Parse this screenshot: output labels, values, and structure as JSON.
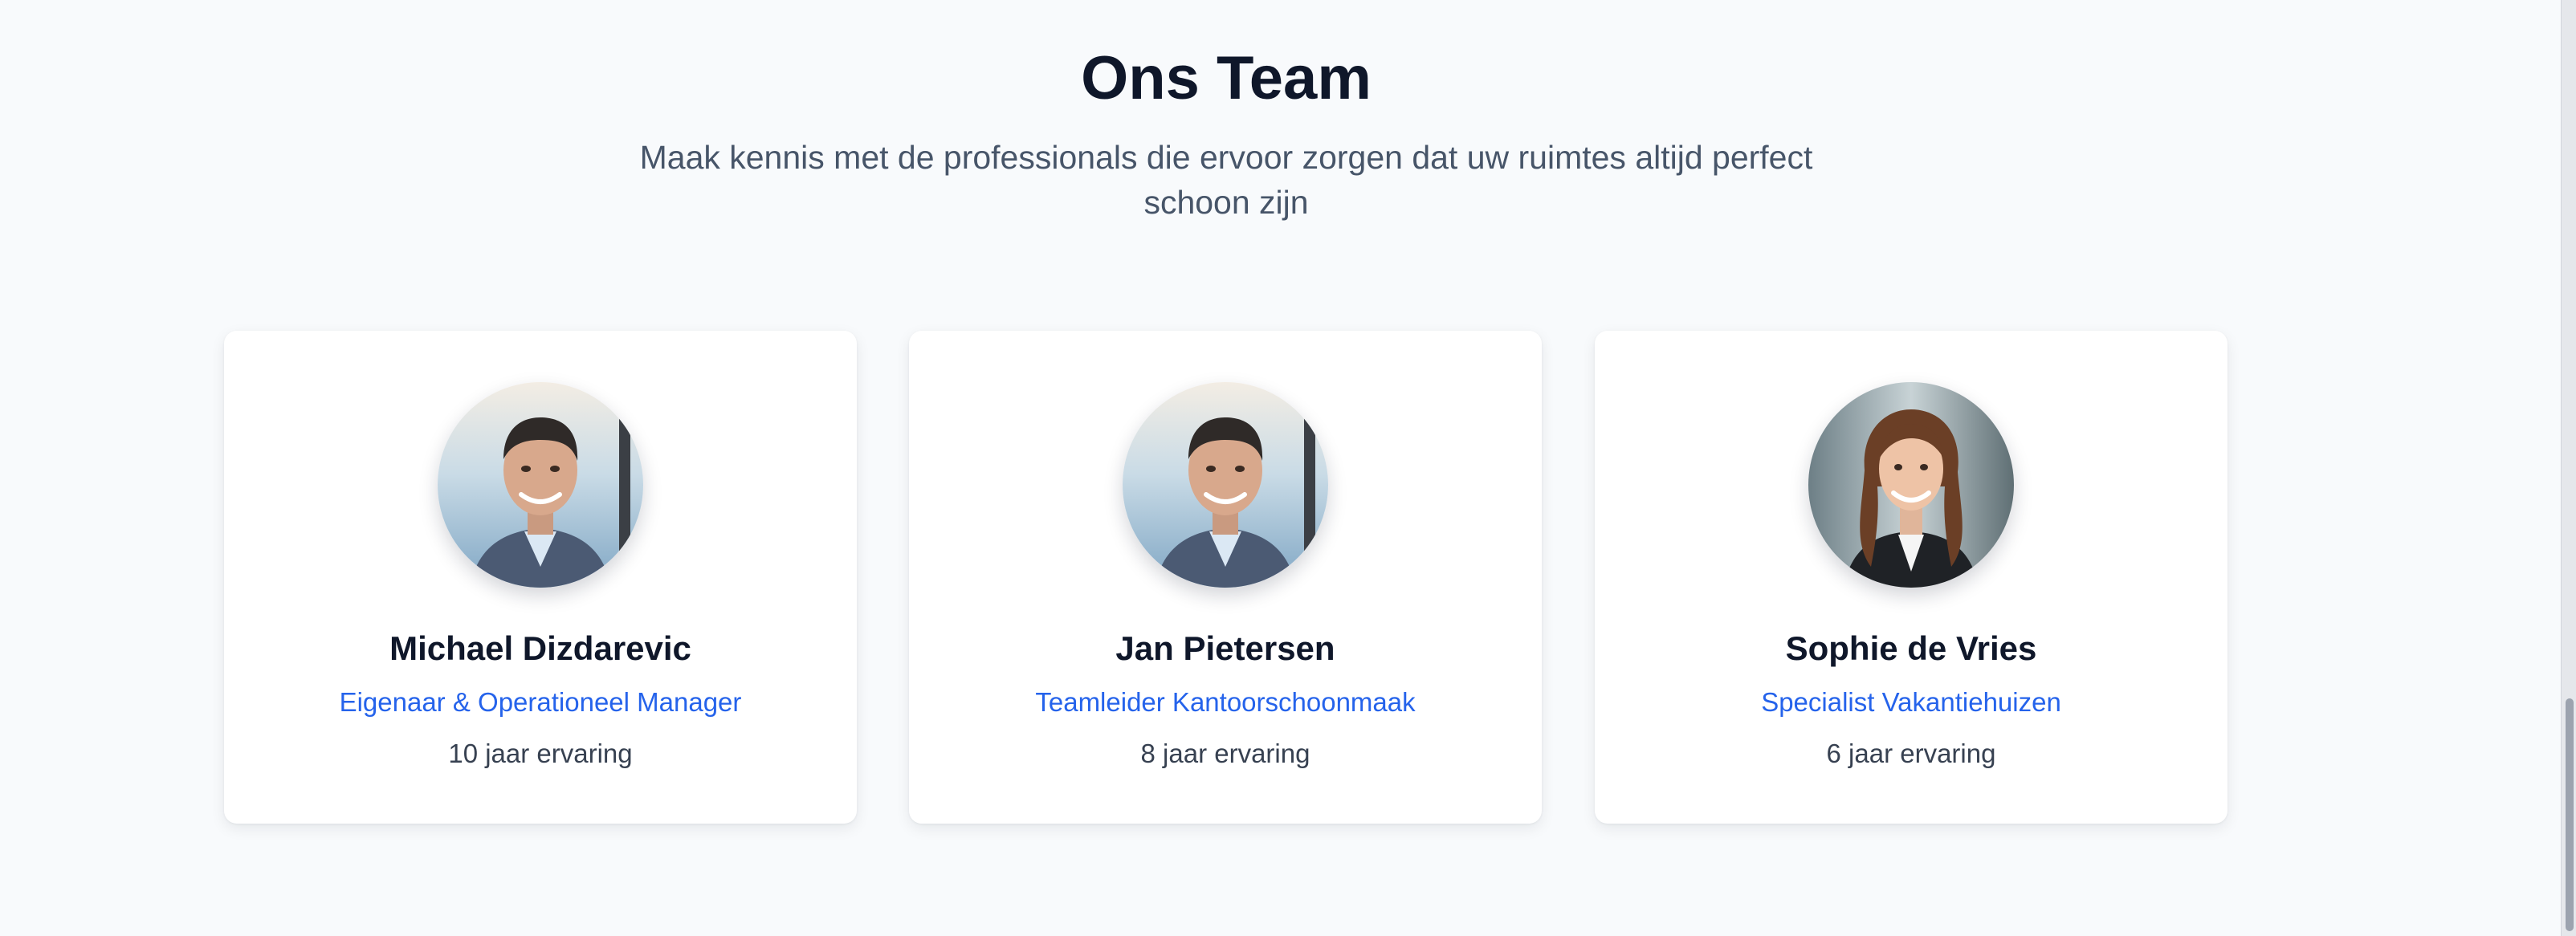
{
  "team": {
    "title": "Ons Team",
    "subtitle": "Maak kennis met de professionals die ervoor zorgen dat uw ruimtes altijd perfect schoon zijn",
    "members": [
      {
        "name": "Michael Dizdarevic",
        "role": "Eigenaar & Operationeel Manager",
        "experience": "10 jaar ervaring",
        "photo": "portrait-man-photo"
      },
      {
        "name": "Jan Pietersen",
        "role": "Teamleider Kantoorschoonmaak",
        "experience": "8 jaar ervaring",
        "photo": "portrait-man-photo"
      },
      {
        "name": "Sophie de Vries",
        "role": "Specialist Vakantiehuizen",
        "experience": "6 jaar ervaring",
        "photo": "portrait-woman-photo"
      }
    ]
  },
  "colors": {
    "background": "#f8fafc",
    "title": "#0f172a",
    "subtitle": "#475569",
    "role_accent": "#2563eb",
    "experience": "#374151",
    "card": "#ffffff"
  }
}
